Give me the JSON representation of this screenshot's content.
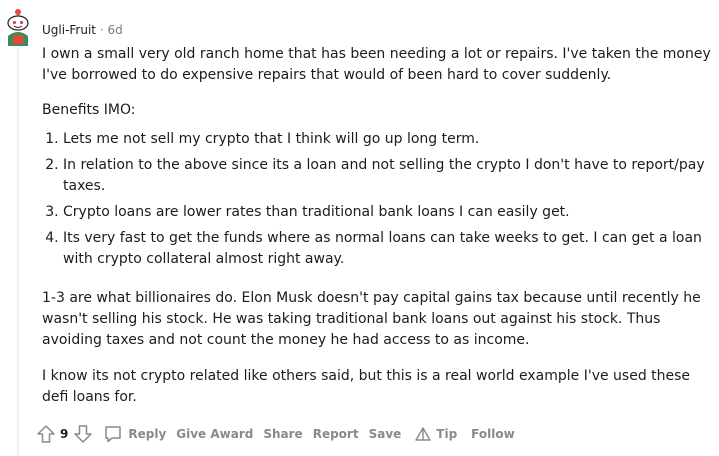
{
  "comment": {
    "author": "Ugli-Fruit",
    "separator": "·",
    "age": "6d",
    "paragraph1": "I own a small very old ranch home that has been needing a lot or repairs. I've taken the money I've borrowed to do expensive repairs that would of been hard to cover suddenly.",
    "paragraph2": "Benefits IMO:",
    "list": [
      "Lets me not sell my crypto that I think will go up long term.",
      "In relation to the above since its a loan and not selling the crypto I don't have to report/pay taxes.",
      "Crypto loans are lower rates than traditional bank loans I can easily get.",
      "Its very fast to get the funds where as normal loans can take weeks to get. I can get a loan with crypto collateral almost right away."
    ],
    "paragraph3": "1-3 are what billionaires do. Elon Musk doesn't pay capital gains tax because until recently he wasn't selling his stock. He was taking traditional bank loans out against his stock. Thus avoiding taxes and not count the money he had access to as income.",
    "paragraph4": "I know its not crypto related like others said, but this is a real world example I've used these defi loans for."
  },
  "actions": {
    "score": "9",
    "reply": "Reply",
    "give_award": "Give Award",
    "share": "Share",
    "report": "Report",
    "save": "Save",
    "tip": "Tip",
    "follow": "Follow"
  },
  "icons": {
    "upvote": "upvote-arrow-icon",
    "downvote": "downvote-arrow-icon",
    "reply": "speech-bubble-icon",
    "tip": "triangle-icon"
  },
  "colors": {
    "avatar_red": "#e8483a",
    "avatar_green": "#3a8c5a",
    "muted": "#878a8c"
  }
}
